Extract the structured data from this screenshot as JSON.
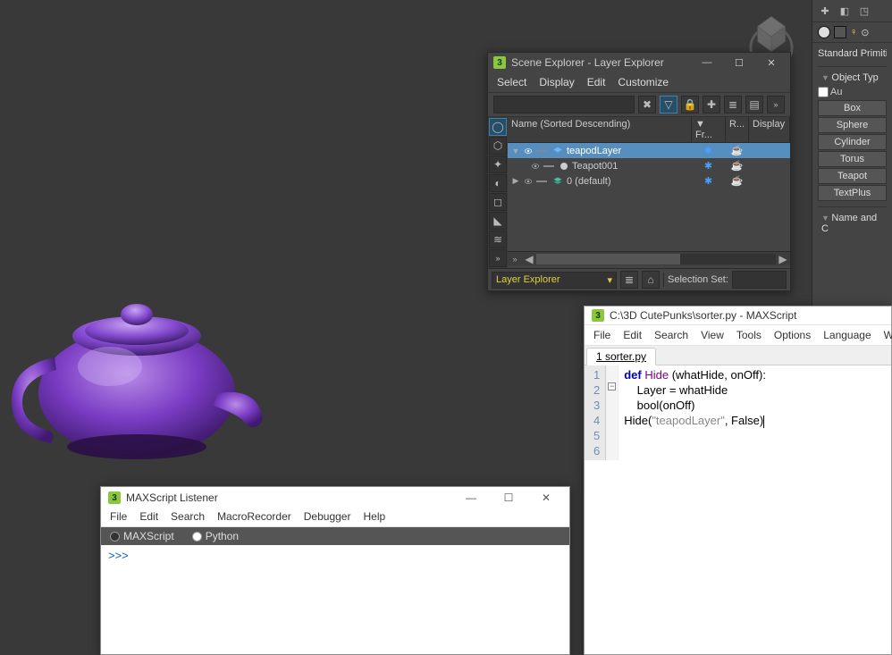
{
  "viewport": {
    "object_label": "Purple Teapot"
  },
  "scene_explorer": {
    "title": "Scene Explorer - Layer Explorer",
    "menu": [
      "Select",
      "Display",
      "Edit",
      "Customize"
    ],
    "search_placeholder": "",
    "columns": {
      "name": "Name (Sorted Descending)",
      "fr": "▼ Fr...",
      "r": "R...",
      "d": "Display"
    },
    "rows": [
      {
        "indent": 0,
        "expanded": true,
        "icon": "layer",
        "label": "teapodLayer",
        "frozen": "✱",
        "render": "☕",
        "selected": true
      },
      {
        "indent": 1,
        "expanded": null,
        "icon": "sphere",
        "label": "Teapot001",
        "frozen": "✱",
        "render": "☕",
        "selected": false
      },
      {
        "indent": 0,
        "expanded": false,
        "icon": "layers",
        "label": "0 (default)",
        "frozen": "✱",
        "render": "☕",
        "selected": false
      }
    ],
    "footer": {
      "mode": "Layer Explorer",
      "selection_set_label": "Selection Set:"
    }
  },
  "right_panel": {
    "catalog": "Standard Primiti",
    "object_type_header": "Object Typ",
    "autogrid_label": "Au",
    "buttons": [
      "Box",
      "Sphere",
      "Cylinder",
      "Torus",
      "Teapot",
      "TextPlus"
    ],
    "name_header": "Name and C"
  },
  "ms_editor": {
    "title": "C:\\3D CutePunks\\sorter.py - MAXScript",
    "menu": [
      "File",
      "Edit",
      "Search",
      "View",
      "Tools",
      "Options",
      "Language",
      "Wind"
    ],
    "tab": "1 sorter.py",
    "gutter": [
      "1",
      "2",
      "3",
      "4",
      "5",
      "6"
    ],
    "code": {
      "l1": "",
      "l2_def": "def ",
      "l2_fn": "Hide ",
      "l2_rest": "(whatHide, onOff):",
      "l3": "    Layer = whatHide",
      "l4": "    bool(onOff)",
      "l5": "",
      "l6a": "Hide(",
      "l6b": "\"teapodLayer\"",
      "l6c": ", False)"
    }
  },
  "listener": {
    "title": "MAXScript Listener",
    "menu": [
      "File",
      "Edit",
      "Search",
      "MacroRecorder",
      "Debugger",
      "Help"
    ],
    "tabs": {
      "maxscript": "MAXScript",
      "python": "Python",
      "selected": "python"
    },
    "prompt": ">>> "
  }
}
